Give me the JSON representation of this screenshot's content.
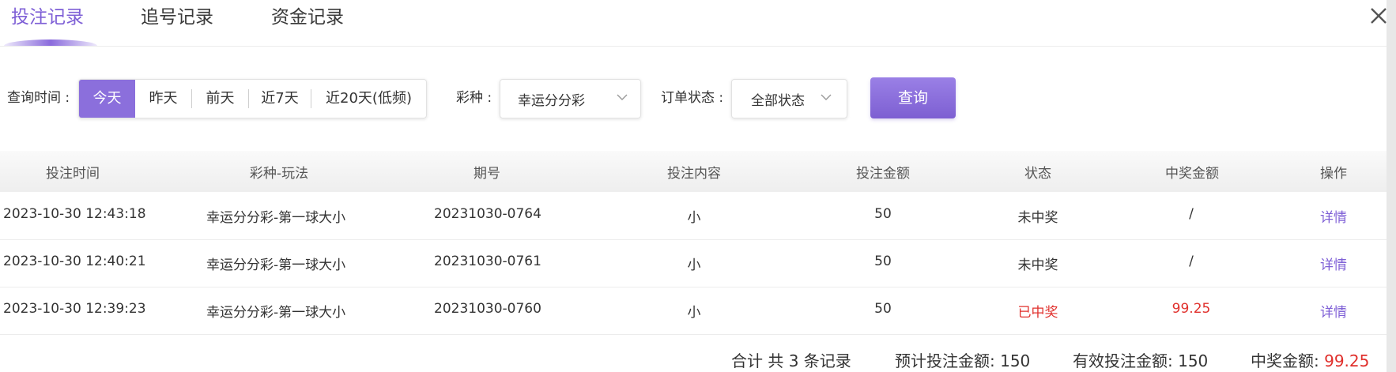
{
  "tabs": [
    {
      "label": "投注记录",
      "active": true
    },
    {
      "label": "追号记录",
      "active": false
    },
    {
      "label": "资金记录",
      "active": false
    }
  ],
  "filters": {
    "time_label": "查询时间 :",
    "date_options": [
      "今天",
      "昨天",
      "前天",
      "近7天",
      "近20天(低频)"
    ],
    "active_date": "今天",
    "lottery_label": "彩种 :",
    "lottery_value": "幸运分分彩",
    "status_label": "订单状态 :",
    "status_value": "全部状态",
    "query_label": "查询"
  },
  "table": {
    "columns": [
      "投注时间",
      "彩种-玩法",
      "期号",
      "投注内容",
      "投注金额",
      "状态",
      "中奖金额",
      "操作"
    ],
    "rows": [
      {
        "time": "2023-10-30 12:43:18",
        "game": "幸运分分彩-第一球大小",
        "issue": "20231030-0764",
        "content": "小",
        "amount": "50",
        "status": "未中奖",
        "prize": "/",
        "action": "详情",
        "won": false
      },
      {
        "time": "2023-10-30 12:40:21",
        "game": "幸运分分彩-第一球大小",
        "issue": "20231030-0761",
        "content": "小",
        "amount": "50",
        "status": "未中奖",
        "prize": "/",
        "action": "详情",
        "won": false
      },
      {
        "time": "2023-10-30 12:39:23",
        "game": "幸运分分彩-第一球大小",
        "issue": "20231030-0760",
        "content": "小",
        "amount": "50",
        "status": "已中奖",
        "prize": "99.25",
        "action": "详情",
        "won": true
      }
    ]
  },
  "summary": {
    "count_text": "合计 共 3 条记录",
    "expected_label": "预计投注金额: ",
    "expected_value": "150",
    "valid_label": "有效投注金额: ",
    "valid_value": "150",
    "prize_label": "中奖金额: ",
    "prize_value": "99.25"
  },
  "colors": {
    "accent": "#8b6fdc",
    "won": "#e0302c"
  },
  "icons": {
    "close": "close-icon",
    "dropdown": "chevron-down-icon"
  }
}
